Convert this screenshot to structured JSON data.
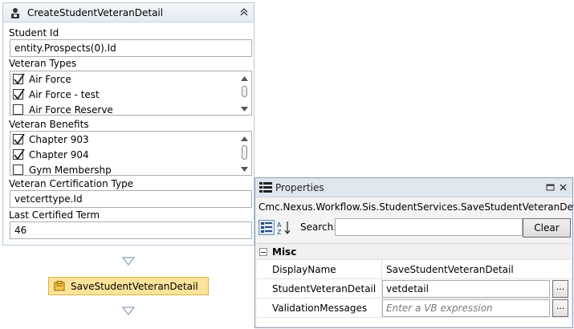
{
  "activity": {
    "title": "CreateStudentVeteranDetail",
    "icon": "student-person-icon",
    "student_id": {
      "label": "Student Id",
      "value": "entity.Prospects(0).Id"
    },
    "veteran_types": {
      "label": "Veteran Types",
      "items": [
        {
          "label": "Air Force",
          "checked": true
        },
        {
          "label": "Air Force - test",
          "checked": true
        },
        {
          "label": "Air Force Reserve",
          "checked": false
        }
      ]
    },
    "veteran_benefits": {
      "label": "Veteran Benefits",
      "items": [
        {
          "label": "Chapter 903",
          "checked": true
        },
        {
          "label": "Chapter 904",
          "checked": true
        },
        {
          "label": "Gym Membershp",
          "checked": false
        }
      ]
    },
    "certification_type": {
      "label": "Veteran Certification Type",
      "value": "vetcerttype.Id"
    },
    "last_certified_term": {
      "label": "Last Certified Term",
      "value": "46"
    }
  },
  "flow": {
    "next_activity": "SaveStudentVeteranDetail"
  },
  "properties": {
    "title": "Properties",
    "type_name": "Cmc.Nexus.Workflow.Sis.StudentServices.SaveStudentVeteranDetail",
    "search_label": "Search:",
    "search_value": "",
    "clear_label": "Clear",
    "category": "Misc",
    "rows": [
      {
        "name": "DisplayName",
        "value": "SaveStudentVeteranDetail",
        "editable": false
      },
      {
        "name": "StudentVeteranDetail",
        "value": "vetdetail",
        "editable": true
      },
      {
        "name": "ValidationMessages",
        "value": "",
        "placeholder": "Enter a VB expression",
        "editable": true
      }
    ],
    "ellipsis_label": "..."
  },
  "colors": {
    "activity_box": "#fbe49a",
    "header_bg": "#e4ebf3",
    "panel_border": "#8e9cb0"
  }
}
